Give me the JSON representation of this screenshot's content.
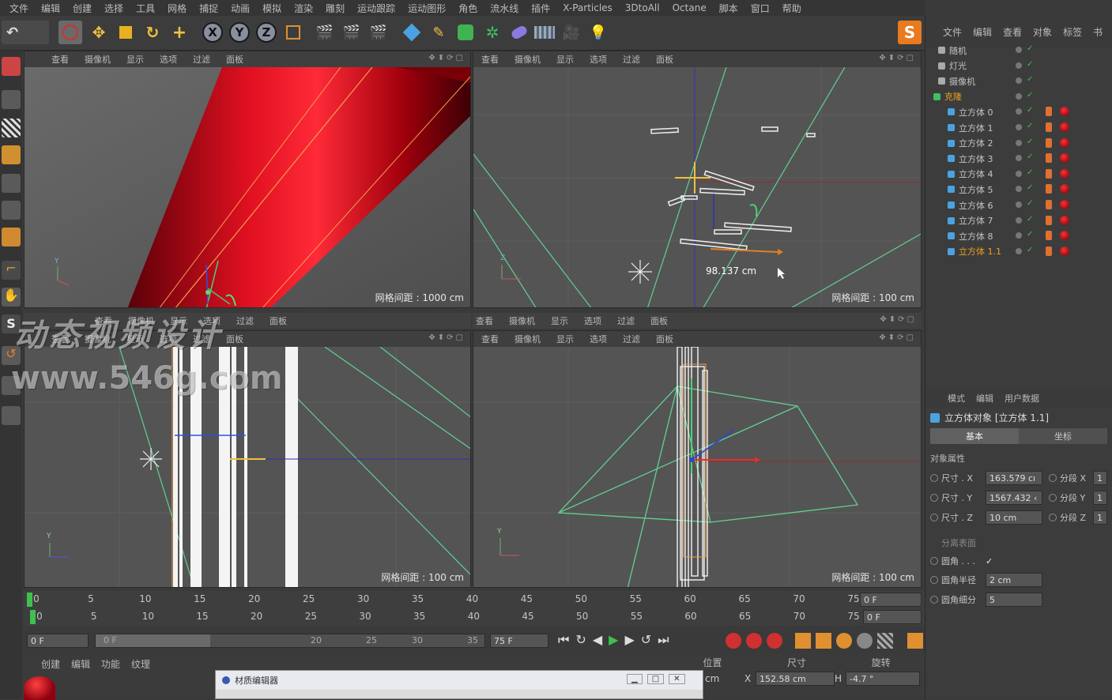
{
  "menu": [
    "文件",
    "编辑",
    "创建",
    "选择",
    "工具",
    "网格",
    "捕捉",
    "动画",
    "模拟",
    "渲染",
    "雕刻",
    "运动跟踪",
    "运动图形",
    "角色",
    "流水线",
    "插件",
    "X-Particles",
    "3DtoAll",
    "Octane",
    "脚本",
    "窗口",
    "帮助"
  ],
  "toolbar": {
    "x": "X",
    "y": "Y",
    "z": "Z",
    "brand": "S"
  },
  "viewports": {
    "tl": {
      "menu": [
        "查看",
        "摄像机",
        "显示",
        "选项",
        "过滤",
        "面板"
      ],
      "grid": "网格间距 : 1000 cm"
    },
    "tr": {
      "menu": [
        "查看",
        "摄像机",
        "显示",
        "选项",
        "过滤",
        "面板"
      ],
      "grid": "网格间距 : 100 cm",
      "measure": "98.137 cm"
    },
    "bl": {
      "menu": [
        "查看",
        "摄像机",
        "显示",
        "选项",
        "过滤",
        "面板"
      ],
      "grid": "网格间距 : 100 cm"
    },
    "br": {
      "menu": [
        "查看",
        "摄像机",
        "显示",
        "选项",
        "过滤",
        "面板"
      ],
      "grid": "网格间距 : 100 cm"
    },
    "mid_menu": [
      "查看",
      "摄像机",
      "显示",
      "选项",
      "过滤",
      "面板"
    ]
  },
  "watermark": {
    "line1": "动态视频设计",
    "line2": "www.546g.com"
  },
  "objects": {
    "tabs": [
      "文件",
      "编辑",
      "查看",
      "对象",
      "标签",
      "书"
    ],
    "items": [
      {
        "name": "随机",
        "indent": 1
      },
      {
        "name": "灯光",
        "indent": 1
      },
      {
        "name": "摄像机",
        "indent": 1
      },
      {
        "name": "克隆",
        "indent": 0
      },
      {
        "name": "立方体 0",
        "indent": 2
      },
      {
        "name": "立方体 1",
        "indent": 2
      },
      {
        "name": "立方体 2",
        "indent": 2
      },
      {
        "name": "立方体 3",
        "indent": 2
      },
      {
        "name": "立方体 4",
        "indent": 2
      },
      {
        "name": "立方体 5",
        "indent": 2
      },
      {
        "name": "立方体 6",
        "indent": 2
      },
      {
        "name": "立方体 7",
        "indent": 2
      },
      {
        "name": "立方体 8",
        "indent": 2
      },
      {
        "name": "立方体 1.1",
        "indent": 2
      }
    ]
  },
  "attributes": {
    "tabs": [
      "模式",
      "编辑",
      "用户数据"
    ],
    "title": "立方体对象 [立方体 1.1]",
    "subtabs": [
      "基本",
      "坐标"
    ],
    "section": "对象属性",
    "size_x_label": "尺寸 . X",
    "size_x": "163.579 cı",
    "size_y_label": "尺寸 . Y",
    "size_y": "1567.432 ‹",
    "size_z_label": "尺寸 . Z",
    "size_z": "10 cm",
    "seg_x_label": "分段 X",
    "seg_x": "1",
    "seg_y_label": "分段 Y",
    "seg_y": "1",
    "seg_z_label": "分段 Z",
    "seg_z": "1",
    "sep_label": "分离表面",
    "fillet_label": "圆角 . . .",
    "fillet_check": "✓",
    "fillet_r_label": "圆角半径",
    "fillet_r": "2 cm",
    "fillet_s_label": "圆角细分",
    "fillet_s": "5"
  },
  "timeline": {
    "ticks": [
      "0",
      "5",
      "10",
      "15",
      "20",
      "25",
      "30",
      "35",
      "40",
      "45",
      "50",
      "55",
      "60",
      "65",
      "70",
      "75"
    ],
    "frame1": "0 F",
    "frame2": "0 F"
  },
  "transport": {
    "start": "0 F",
    "range_a": "0 F",
    "range_b": "20",
    "range_c": "25",
    "range_d": "30",
    "range_e": "35",
    "end": "75 F"
  },
  "bottom": {
    "tabs": [
      "创建",
      "编辑",
      "功能",
      "纹理"
    ],
    "coord_hdr": [
      "位置",
      "尺寸",
      "旋转"
    ],
    "pos_unit": "cm",
    "size_x_lbl": "X",
    "size_x": "152.58 cm",
    "rot_lbl": "H",
    "rot": "-4.7 °"
  },
  "material_window": {
    "title": "材质编辑器"
  }
}
